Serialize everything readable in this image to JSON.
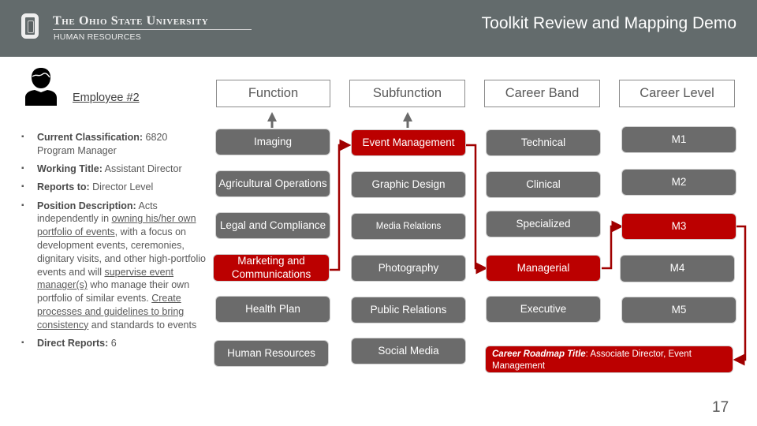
{
  "header": {
    "university": "The Ohio State University",
    "department": "HUMAN RESOURCES",
    "title": "Toolkit Review and Mapping Demo"
  },
  "employee": {
    "label": "Employee #2",
    "icon": "person-icon",
    "details": [
      {
        "label": "Current Classification:",
        "value": "6820 Program Manager"
      },
      {
        "label": "Working Title:",
        "value": "Assistant Director"
      },
      {
        "label": "Reports to:",
        "value": "Director Level"
      },
      {
        "label": "Position Description:",
        "segments": [
          {
            "text": " Acts independently in ",
            "underline": false
          },
          {
            "text": "owning his/her own portfolio of events",
            "underline": true
          },
          {
            "text": ", with a focus on development events, ceremonies, dignitary visits, and other high-portfolio events and will ",
            "underline": false
          },
          {
            "text": "supervise event manager(s)",
            "underline": true
          },
          {
            "text": " who manage their own portfolio of similar events. ",
            "underline": false
          },
          {
            "text": "Create processes and guidelines to bring consistency",
            "underline": true
          },
          {
            "text": " and standards to events",
            "underline": false
          }
        ]
      },
      {
        "label": "Direct Reports:",
        "value": "6"
      }
    ]
  },
  "columns": [
    {
      "header": "Function",
      "items": [
        "Imaging",
        "Agricultural Operations",
        "Legal and Compliance",
        "Marketing and Communications",
        "Health Plan",
        "Human Resources"
      ],
      "selected": 3
    },
    {
      "header": "Subfunction",
      "items": [
        "Event Management",
        "Graphic Design",
        "Media Relations",
        "Photography",
        "Public Relations",
        "Social Media"
      ],
      "selected": 0
    },
    {
      "header": "Career Band",
      "items": [
        "Technical",
        "Clinical",
        "Specialized",
        "Managerial",
        "Executive"
      ],
      "selected": 3
    },
    {
      "header": "Career Level",
      "items": [
        "M1",
        "M2",
        "M3",
        "M4",
        "M5"
      ],
      "selected": 2
    }
  ],
  "roadmap": {
    "label": "Career Roadmap Title",
    "value": ": Associate Director, Event Management"
  },
  "colors": {
    "header_bg": "#636b6c",
    "box_gray": "#6b6b6b",
    "highlight_red": "#bb0000",
    "connector": "#a00000"
  },
  "page_number": "17"
}
